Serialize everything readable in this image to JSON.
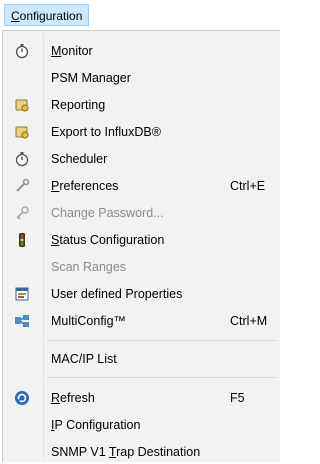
{
  "menubar": {
    "label_pre": "",
    "label_mn": "C",
    "label_post": "onfiguration"
  },
  "menu": {
    "items": [
      {
        "pre": "",
        "mn": "M",
        "post": "onitor",
        "shortcut": "",
        "icon": "stopwatch-icon"
      },
      {
        "pre": "PSM Manager",
        "mn": "",
        "post": "",
        "shortcut": "",
        "icon": ""
      },
      {
        "pre": "Reporting",
        "mn": "",
        "post": "",
        "shortcut": "",
        "icon": "report-icon"
      },
      {
        "pre": "Export to InfluxDB®",
        "mn": "",
        "post": "",
        "shortcut": "",
        "icon": "export-icon"
      },
      {
        "pre": "Scheduler",
        "mn": "",
        "post": "",
        "shortcut": "",
        "icon": "stopwatch-icon"
      },
      {
        "pre": "",
        "mn": "P",
        "post": "references",
        "shortcut": "Ctrl+E",
        "icon": "wrench-icon"
      },
      {
        "pre": "Change Password...",
        "mn": "",
        "post": "",
        "shortcut": "",
        "icon": "key-icon",
        "disabled": true
      },
      {
        "pre": "",
        "mn": "S",
        "post": "tatus Configuration",
        "shortcut": "",
        "icon": "traffic-light-icon"
      },
      {
        "pre": "Scan Ranges",
        "mn": "",
        "post": "",
        "shortcut": "",
        "icon": "",
        "disabled": true
      },
      {
        "pre": "User defined Properties",
        "mn": "",
        "post": "",
        "shortcut": "",
        "icon": "properties-icon"
      },
      {
        "pre": "MultiConfig™",
        "mn": "",
        "post": "",
        "shortcut": "Ctrl+M",
        "icon": "network-icon"
      },
      {
        "pre": "MAC/IP List",
        "mn": "",
        "post": "",
        "shortcut": "",
        "icon": ""
      },
      {
        "pre": "",
        "mn": "R",
        "post": "efresh",
        "shortcut": "F5",
        "icon": "refresh-icon"
      },
      {
        "pre": "",
        "mn": "I",
        "post": "P Configuration",
        "shortcut": "",
        "icon": ""
      },
      {
        "pre": "SNMP V1 ",
        "mn": "T",
        "post": "rap Destination",
        "shortcut": "",
        "icon": ""
      }
    ]
  },
  "colors": {
    "menubar_highlight": "#cce8ff",
    "menu_background": "#f2f2f2",
    "disabled_text": "#8c8c8c"
  }
}
